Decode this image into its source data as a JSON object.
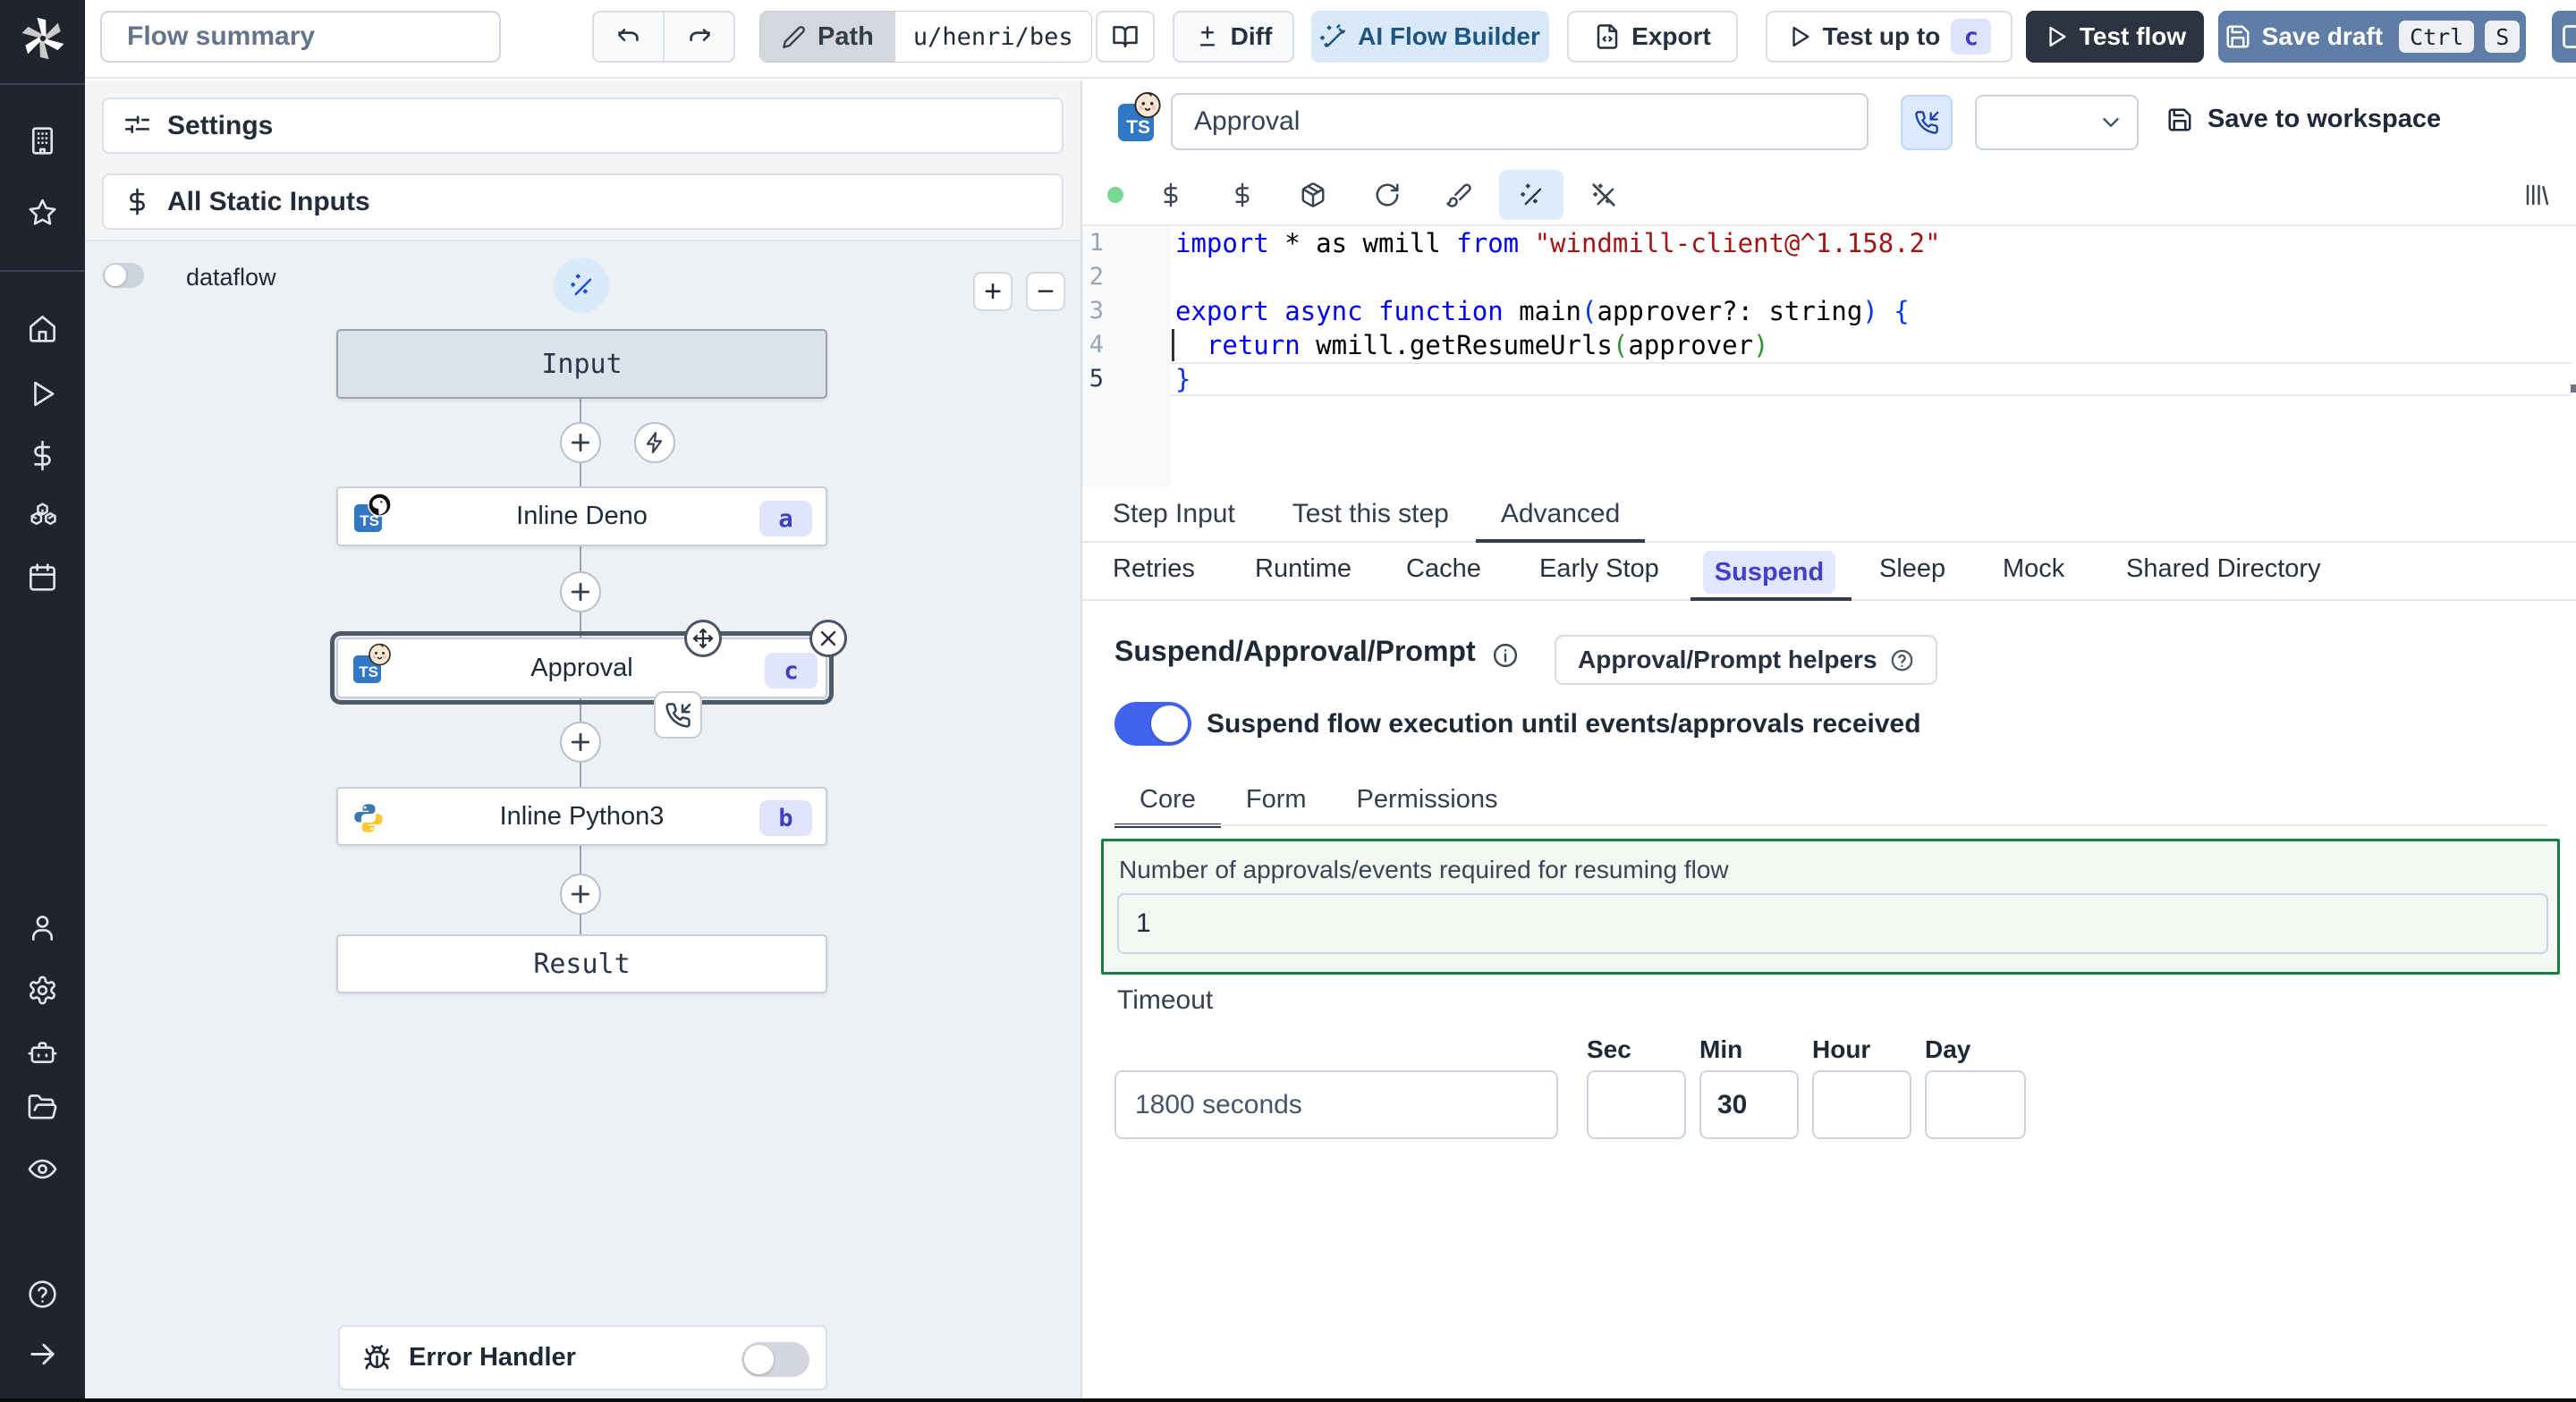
{
  "colors": {
    "accent_blue_toggle": "#4263eb",
    "selected_node_ring": "#4b5563",
    "green_highlight_border": "#15803d",
    "save_draft_button": "#5f7ea7",
    "test_flow_button": "#2b3440",
    "ai_button_bg": "#d9e9f8",
    "badge_bg": "#e1e5fb",
    "badge_text": "#3f3fc3",
    "sidebar_bg": "#20242e"
  },
  "sidebar": {
    "items": [
      {
        "icon": "windmill-logo"
      },
      {
        "icon": "building"
      },
      {
        "icon": "star"
      },
      {
        "icon": "home"
      },
      {
        "icon": "play"
      },
      {
        "icon": "dollar-sign"
      },
      {
        "icon": "boxes"
      },
      {
        "icon": "calendar"
      },
      {
        "icon": "user"
      },
      {
        "icon": "gear"
      },
      {
        "icon": "worker-bot"
      },
      {
        "icon": "folder-open"
      },
      {
        "icon": "eye"
      },
      {
        "icon": "help-circle"
      },
      {
        "icon": "arrow-right"
      }
    ]
  },
  "topbar": {
    "flow_summary_placeholder": "Flow summary",
    "path_label": "Path",
    "path_value": "u/henri/bes",
    "diff_label": "Diff",
    "diff_icon_text": "±",
    "ai_flow_builder_label": "AI Flow Builder",
    "export_label": "Export",
    "test_up_to_label": "Test up to",
    "test_up_to_badge": "c",
    "test_flow_label": "Test flow",
    "save_draft_label": "Save draft",
    "kbd_ctrl": "Ctrl",
    "kbd_s": "S"
  },
  "flow_panel": {
    "settings_label": "Settings",
    "static_inputs_label": "All Static Inputs",
    "dataflow_label": "dataflow",
    "zoom_in_label": "+",
    "zoom_out_label": "−",
    "nodes": {
      "input": {
        "label": "Input"
      },
      "deno": {
        "label": "Inline Deno",
        "badge": "a",
        "lang": "TS"
      },
      "approval": {
        "label": "Approval",
        "badge": "c",
        "lang": "TS"
      },
      "python": {
        "label": "Inline Python3",
        "badge": "b"
      },
      "result": {
        "label": "Result"
      }
    },
    "error_handler_label": "Error Handler"
  },
  "step_editor": {
    "language_badge": "TS",
    "name_value": "Approval",
    "save_to_workspace_label": "Save to workspace",
    "code": {
      "active_line": 5,
      "lines": [
        {
          "num": 1,
          "tokens": [
            {
              "t": "import",
              "c": "kw"
            },
            {
              "t": " * as wmill ",
              "c": "pl"
            },
            {
              "t": "from",
              "c": "kw"
            },
            {
              "t": " ",
              "c": "pl"
            },
            {
              "t": "\"windmill-client@^1.158.2\"",
              "c": "str"
            }
          ]
        },
        {
          "num": 2,
          "tokens": []
        },
        {
          "num": 3,
          "tokens": [
            {
              "t": "export",
              "c": "kw"
            },
            {
              "t": " ",
              "c": "pl"
            },
            {
              "t": "async",
              "c": "kw"
            },
            {
              "t": " ",
              "c": "pl"
            },
            {
              "t": "function",
              "c": "kw"
            },
            {
              "t": " main",
              "c": "pl"
            },
            {
              "t": "(",
              "c": "br1"
            },
            {
              "t": "approver?: string",
              "c": "pl"
            },
            {
              "t": ")",
              "c": "br1"
            },
            {
              "t": " ",
              "c": "pl"
            },
            {
              "t": "{",
              "c": "br1"
            }
          ]
        },
        {
          "num": 4,
          "tokens": [
            {
              "t": "  ",
              "c": "pl"
            },
            {
              "t": "return",
              "c": "kw"
            },
            {
              "t": " wmill.getResumeUrls",
              "c": "pl"
            },
            {
              "t": "(",
              "c": "br2"
            },
            {
              "t": "approver",
              "c": "pl"
            },
            {
              "t": ")",
              "c": "br2"
            }
          ]
        },
        {
          "num": 5,
          "tokens": [
            {
              "t": "}",
              "c": "br1"
            }
          ]
        }
      ]
    },
    "tabs": [
      "Step Input",
      "Test this step",
      "Advanced"
    ],
    "active_tab": "Advanced",
    "advanced_tabs": [
      "Retries",
      "Runtime",
      "Cache",
      "Early Stop",
      "Suspend",
      "Sleep",
      "Mock",
      "Shared Directory"
    ],
    "active_advanced_tab": "Suspend",
    "suspend": {
      "title": "Suspend/Approval/Prompt",
      "helpers_label": "Approval/Prompt helpers",
      "toggle_label": "Suspend flow execution until events/approvals received",
      "toggle_on": true,
      "sub_tabs": [
        "Core",
        "Form",
        "Permissions"
      ],
      "active_sub_tab": "Core",
      "approvals_label": "Number of approvals/events required for resuming flow",
      "approvals_value": "1",
      "timeout_label": "Timeout",
      "timeout_placeholder": "1800 seconds",
      "units": [
        {
          "label": "Sec",
          "value": ""
        },
        {
          "label": "Min",
          "value": "30"
        },
        {
          "label": "Hour",
          "value": ""
        },
        {
          "label": "Day",
          "value": ""
        }
      ]
    }
  }
}
